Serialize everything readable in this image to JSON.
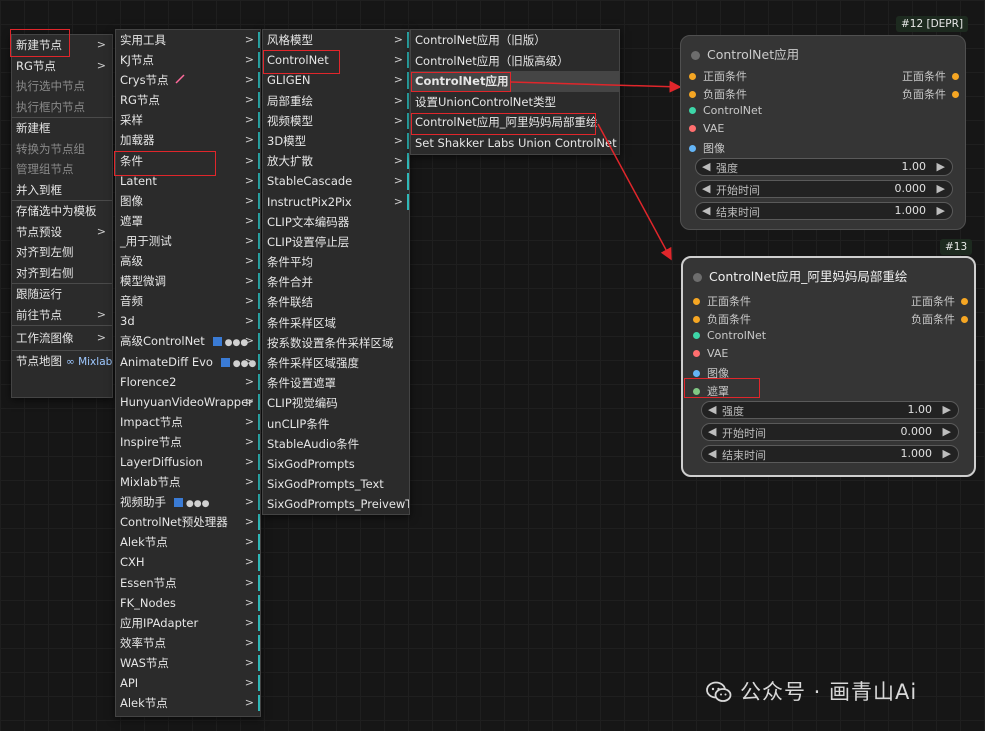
{
  "menu1": {
    "items": [
      {
        "label": "新建节点",
        "arrow": ">"
      },
      {
        "label": "RG节点",
        "arrow": ">",
        "icon": "rg-icon"
      },
      {
        "label": "执行选中节点",
        "disabled": true
      },
      {
        "label": "执行框内节点",
        "disabled": true
      },
      {
        "label": "新建框"
      },
      {
        "label": "转换为节点组",
        "disabled": true
      },
      {
        "label": "管理组节点",
        "disabled": true
      },
      {
        "label": "并入到框"
      },
      {
        "label": "存储选中为模板"
      },
      {
        "label": "节点预设",
        "arrow": ">"
      },
      {
        "label": "对齐到左侧"
      },
      {
        "label": "对齐到右侧"
      },
      {
        "label": "跟随运行"
      },
      {
        "label": "前往节点",
        "arrow": ">"
      },
      {
        "label": "工作流图像",
        "arrow": ">"
      },
      {
        "label": "节点地图",
        "suffix": "∞ Mixlab"
      }
    ]
  },
  "menu2": {
    "items": [
      "实用工具",
      "KJ节点",
      "Crys节点",
      "RG节点",
      "采样",
      "加载器",
      "条件",
      "Latent",
      "图像",
      "遮罩",
      "_用于测试",
      "高级",
      "模型微调",
      "音频",
      "3d",
      "高级ControlNet",
      "AnimateDiff Evo",
      "Florence2",
      "HunyuanVideoWrapper",
      "Impact节点",
      "Inspire节点",
      "LayerDiffusion",
      "Mixlab节点",
      "视频助手",
      "ControlNet预处理器",
      "Alek节点",
      "CXH",
      "Essen节点",
      "FK_Nodes",
      "应用IPAdapter",
      "效率节点",
      "WAS节点",
      "API",
      "Alek节点"
    ],
    "arrow": ">"
  },
  "menu3": {
    "items": [
      "风格模型",
      "ControlNet",
      "GLIGEN",
      "局部重绘",
      "视频模型",
      "3D模型",
      "放大扩散",
      "StableCascade",
      "InstructPix2Pix",
      "CLIP文本编码器",
      "CLIP设置停止层",
      "条件平均",
      "条件合并",
      "条件联结",
      "条件采样区域",
      "按系数设置条件采样区域",
      "条件采样区域强度",
      "条件设置遮罩",
      "CLIP视觉编码",
      "unCLIP条件",
      "StableAudio条件",
      "SixGodPrompts",
      "SixGodPrompts_Text",
      "SixGodPrompts_PreivewText"
    ],
    "arrow": ">"
  },
  "menu4": {
    "items": [
      "ControlNet应用（旧版）",
      "ControlNet应用（旧版高级）",
      "ControlNet应用",
      "设置UnionControlNet类型",
      "ControlNet应用_阿里妈妈局部重绘",
      "Set Shakker Labs Union ControlNet Type"
    ]
  },
  "node1": {
    "badge": "#12 [DEPR]",
    "title": "ControlNet应用",
    "inputs": [
      "正面条件",
      "负面条件",
      "ControlNet",
      "VAE",
      "图像"
    ],
    "outputs": [
      "正面条件",
      "负面条件"
    ],
    "widgets": [
      {
        "label": "强度",
        "value": "1.00"
      },
      {
        "label": "开始时间",
        "value": "0.000"
      },
      {
        "label": "结束时间",
        "value": "1.000"
      }
    ]
  },
  "node2": {
    "badge": "#13",
    "title": "ControlNet应用_阿里妈妈局部重绘",
    "inputs": [
      "正面条件",
      "负面条件",
      "ControlNet",
      "VAE",
      "图像",
      "遮罩"
    ],
    "outputs": [
      "正面条件",
      "负面条件"
    ],
    "widgets": [
      {
        "label": "强度",
        "value": "1.00"
      },
      {
        "label": "开始时间",
        "value": "0.000"
      },
      {
        "label": "结束时间",
        "value": "1.000"
      }
    ]
  },
  "slot_colors": {
    "cond": "#f5a623",
    "controlnet": "#3dd6a8",
    "vae": "#ff6e6e",
    "image": "#64b5f6",
    "mask": "#81c784"
  },
  "widget_arrows": {
    "left": "◀",
    "right": "▶"
  },
  "watermark": "公众号 · 画青山Ai"
}
